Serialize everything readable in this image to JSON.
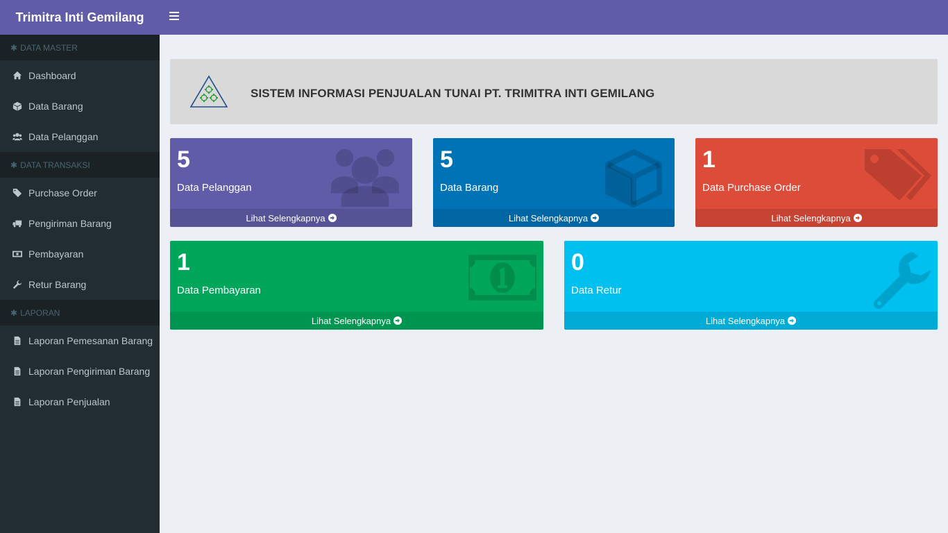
{
  "brand": "Trimitra Inti Gemilang",
  "sidebar": {
    "sections": [
      {
        "header": "DATA MASTER",
        "items": [
          {
            "label": "Dashboard",
            "icon": "home-icon"
          },
          {
            "label": "Data Barang",
            "icon": "cube-icon"
          },
          {
            "label": "Data Pelanggan",
            "icon": "users-icon"
          }
        ]
      },
      {
        "header": "DATA TRANSAKSI",
        "items": [
          {
            "label": "Purchase Order",
            "icon": "tag-icon"
          },
          {
            "label": "Pengiriman Barang",
            "icon": "truck-icon"
          },
          {
            "label": "Pembayaran",
            "icon": "money-icon"
          },
          {
            "label": "Retur Barang",
            "icon": "wrench-icon"
          }
        ]
      },
      {
        "header": "LAPORAN",
        "items": [
          {
            "label": "Laporan Pemesanan Barang",
            "icon": "file-icon"
          },
          {
            "label": "Laporan Pengiriman Barang",
            "icon": "file-icon"
          },
          {
            "label": "Laporan Penjualan",
            "icon": "file-icon"
          }
        ]
      }
    ]
  },
  "banner": {
    "title": "SISTEM INFORMASI PENJUALAN TUNAI PT. TRIMITRA INTI GEMILANG"
  },
  "boxes": [
    {
      "value": "5",
      "label": "Data Pelanggan",
      "link": "Lihat Selengkapnya",
      "icon": "users-icon",
      "color": "#605ca8"
    },
    {
      "value": "5",
      "label": "Data Barang",
      "link": "Lihat Selengkapnya",
      "icon": "cube-icon",
      "color": "#0073b7"
    },
    {
      "value": "1",
      "label": "Data Purchase Order",
      "link": "Lihat Selengkapnya",
      "icon": "tags-icon",
      "color": "#dd4b39"
    },
    {
      "value": "1",
      "label": "Data Pembayaran",
      "link": "Lihat Selengkapnya",
      "icon": "money-icon",
      "color": "#00a65a"
    },
    {
      "value": "0",
      "label": "Data Retur",
      "link": "Lihat Selengkapnya",
      "icon": "wrench-icon",
      "color": "#00c0ef"
    }
  ]
}
